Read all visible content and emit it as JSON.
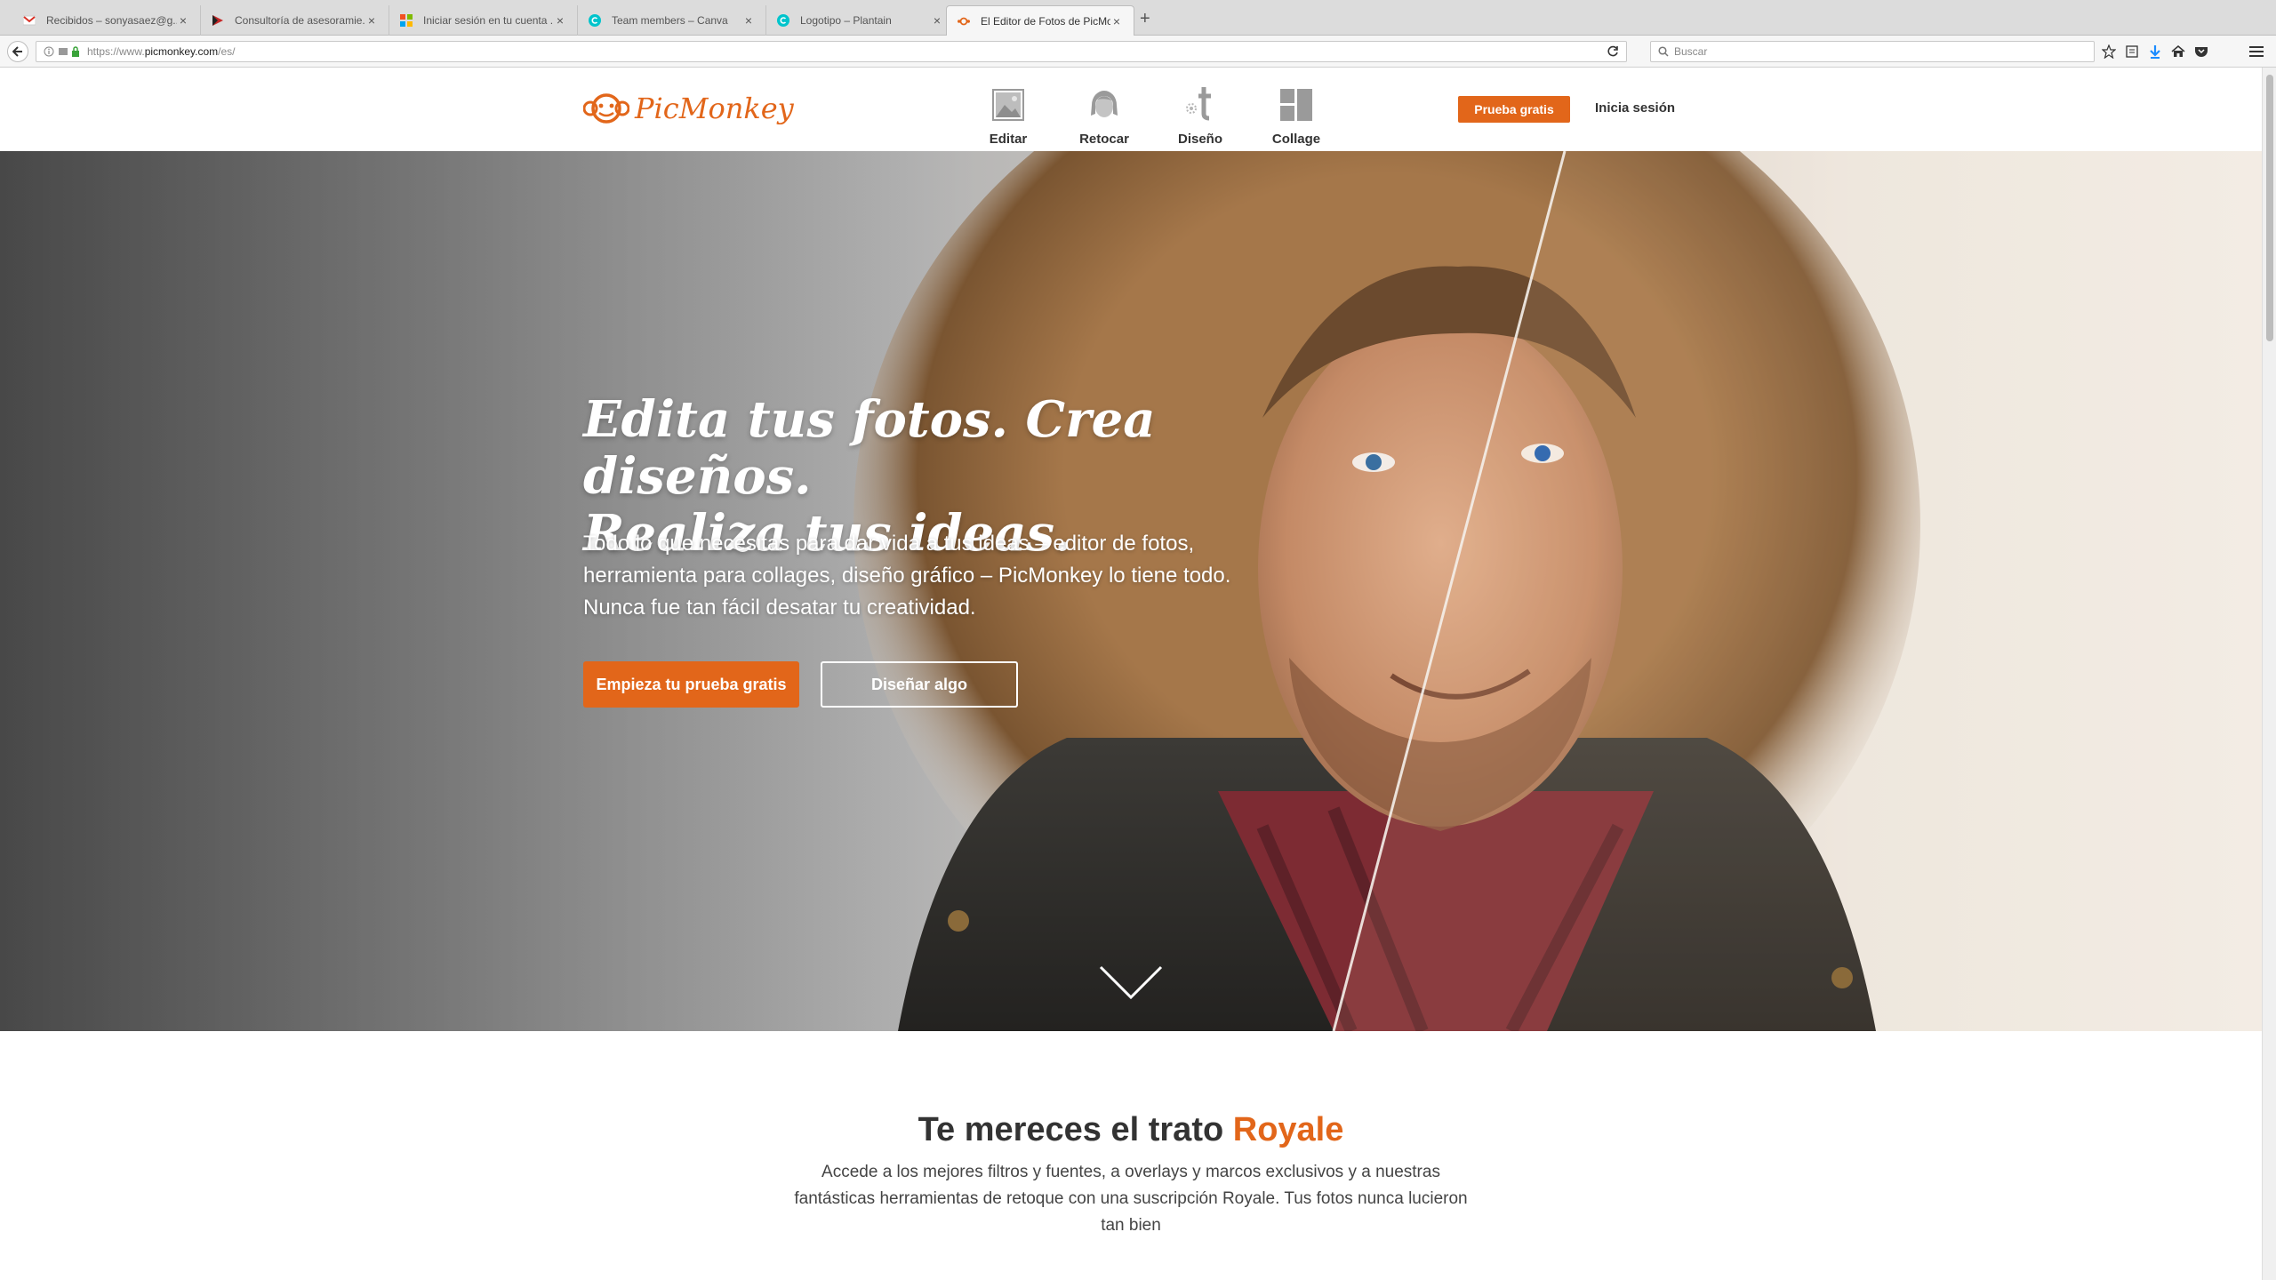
{
  "browser": {
    "tabs": [
      {
        "title": "Recibidos – sonyasaez@g...",
        "icon": "gmail-icon"
      },
      {
        "title": "Consultoría de asesoramie...",
        "icon": "site-flag-icon"
      },
      {
        "title": "Iniciar sesión en tu cuenta ...",
        "icon": "microsoft-icon"
      },
      {
        "title": "Team members – Canva",
        "icon": "canva-icon"
      },
      {
        "title": "Logotipo – Plantain",
        "icon": "canva-icon"
      },
      {
        "title": "El Editor de Fotos de PicMo...",
        "icon": "picmonkey-icon"
      }
    ],
    "url_prefix": "https://www.",
    "url_host": "picmonkey.com",
    "url_path": "/es/",
    "search_placeholder": "Buscar"
  },
  "site": {
    "logo_text": "PicMonkey",
    "nav": [
      {
        "label": "Editar",
        "icon": "edit-photo-icon"
      },
      {
        "label": "Retocar",
        "icon": "touchup-face-icon"
      },
      {
        "label": "Diseño",
        "icon": "design-icon"
      },
      {
        "label": "Collage",
        "icon": "collage-icon"
      }
    ],
    "trial_button": "Prueba gratis",
    "login_link": "Inicia sesión"
  },
  "hero": {
    "title_line1": "Edita tus fotos. Crea diseños.",
    "title_line2": "Realiza tus ideas.",
    "sub_line1": "Todo lo que necesitas para dar vida a tus ideas – editor de fotos,",
    "sub_line2": "herramienta para collages, diseño gráfico – PicMonkey lo tiene todo.",
    "sub_line3": "Nunca fue tan fácil desatar tu creatividad.",
    "start_button": "Empieza tu prueba gratis",
    "design_button": "Diseñar algo"
  },
  "royale": {
    "title_prefix": "Te mereces el trato ",
    "title_accent": "Royale",
    "text_line1": "Accede a los mejores filtros y fuentes, a overlays y marcos exclusivos y a nuestras",
    "text_line2": "fantásticas herramientas de retoque con una suscripción Royale. Tus fotos nunca lucieron",
    "text_line3": "tan bien"
  },
  "colors": {
    "brand_orange": "#e2661a",
    "text_dark": "#333333"
  }
}
